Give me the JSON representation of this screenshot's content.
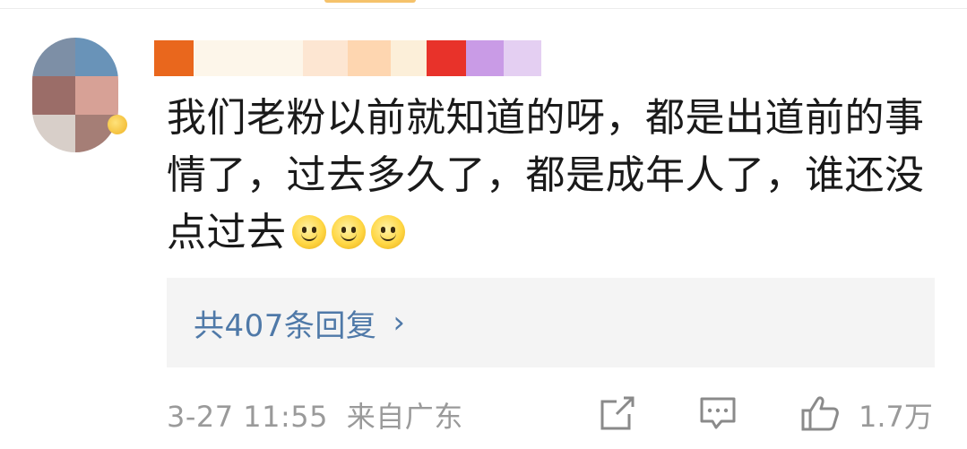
{
  "comment": {
    "text_line1": "我们老粉以前就知道的呀，都是出道前的事",
    "text_line2": "情了，过去多久了，都是成年人了，谁还没",
    "text_line3": "点过去",
    "emojis": [
      "smile-emoji",
      "smile-emoji",
      "smile-emoji"
    ]
  },
  "replies": {
    "label": "共407条回复",
    "chevron": "›"
  },
  "meta": {
    "timestamp": "3-27 11:55",
    "location": "来自广东"
  },
  "actions": {
    "share_icon": "share-icon",
    "comment_icon": "comment-icon",
    "like_icon": "thumbs-up-icon",
    "like_count": "1.7万"
  },
  "colors": {
    "link_blue": "#4f79a8",
    "meta_gray": "#9a9a9a",
    "text": "#1a1a1a",
    "reply_bg": "#f4f4f4"
  }
}
